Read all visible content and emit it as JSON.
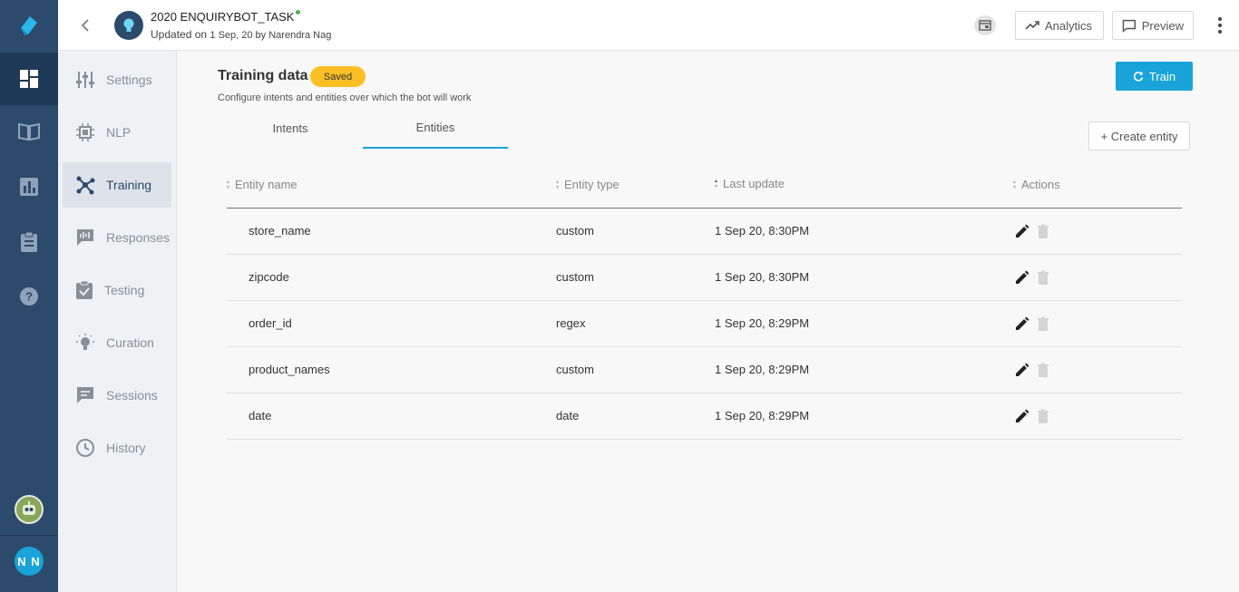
{
  "header": {
    "bot_name": "2020 ENQUIRYBOT_TASK",
    "updated_prefix": "Updated on",
    "updated_detail": "1 Sep, 20 by Narendra Nag",
    "analytics_label": "Analytics",
    "preview_label": "Preview"
  },
  "rail": {
    "avatar_initials": "N N"
  },
  "subnav": {
    "items": [
      {
        "label": "Settings",
        "icon": "sliders-icon"
      },
      {
        "label": "NLP",
        "icon": "chip-icon"
      },
      {
        "label": "Training",
        "icon": "network-icon"
      },
      {
        "label": "Responses",
        "icon": "chat-wave-icon"
      },
      {
        "label": "Testing",
        "icon": "clipboard-check-icon"
      },
      {
        "label": "Curation",
        "icon": "bulb-icon"
      },
      {
        "label": "Sessions",
        "icon": "chat-icon"
      },
      {
        "label": "History",
        "icon": "history-icon"
      }
    ],
    "active": "Training"
  },
  "main": {
    "title": "Training data",
    "status_badge": "Saved",
    "subtitle": "Configure intents and entities over which the bot will work",
    "train_label": "Train",
    "tabs": [
      "Intents",
      "Entities"
    ],
    "active_tab": "Entities",
    "create_label": "+ Create entity",
    "columns": [
      "Entity name",
      "Entity type",
      "Last update",
      "Actions"
    ],
    "rows": [
      {
        "name": "store_name",
        "type": "custom",
        "updated": "1 Sep 20, 8:30PM"
      },
      {
        "name": "zipcode",
        "type": "custom",
        "updated": "1 Sep 20, 8:30PM"
      },
      {
        "name": "order_id",
        "type": "regex",
        "updated": "1 Sep 20, 8:29PM"
      },
      {
        "name": "product_names",
        "type": "custom",
        "updated": "1 Sep 20, 8:29PM"
      },
      {
        "name": "date",
        "type": "date",
        "updated": "1 Sep 20, 8:29PM"
      }
    ]
  },
  "colors": {
    "rail": "#2c4a6b",
    "accent": "#1aa3d9",
    "badge": "#fbbf24"
  }
}
